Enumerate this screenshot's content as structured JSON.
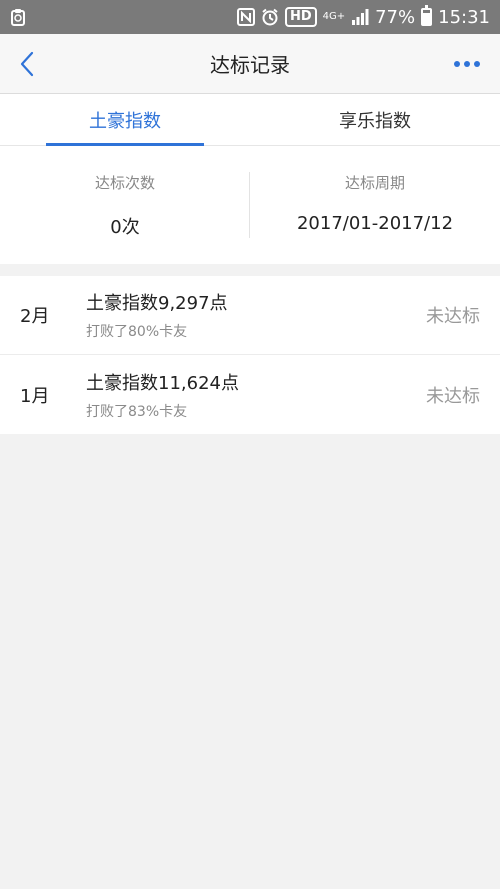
{
  "status_bar": {
    "battery": "77%",
    "time": "15:31",
    "hd": "HD",
    "network": "4G+",
    "battery_level_percent": 77
  },
  "nav": {
    "title": "达标记录"
  },
  "tabs": [
    {
      "label": "土豪指数",
      "active": true
    },
    {
      "label": "享乐指数",
      "active": false
    }
  ],
  "summary": {
    "count_label": "达标次数",
    "count_value": "0次",
    "period_label": "达标周期",
    "period_value": "2017/01-2017/12"
  },
  "records": [
    {
      "month": "2月",
      "points": "土豪指数9,297点",
      "beat": "打败了80%卡友",
      "status": "未达标"
    },
    {
      "month": "1月",
      "points": "土豪指数11,624点",
      "beat": "打败了83%卡友",
      "status": "未达标"
    }
  ],
  "colors": {
    "accent": "#2f73d8",
    "status_bar": "#7a7a7a",
    "background": "#f2f2f2"
  }
}
